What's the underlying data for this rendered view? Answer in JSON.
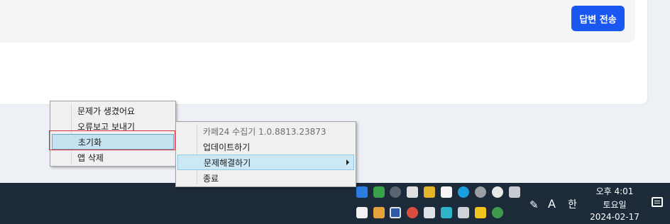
{
  "page": {
    "submit_button": "답변 전송"
  },
  "tray_menu": {
    "items": [
      "문제가 생겼어요",
      "오류보고 보내기",
      "초기화",
      "앱 삭제"
    ]
  },
  "app_menu": {
    "items": [
      "카페24 수집기 1.0.8813.23873",
      "업데이트하기",
      "문제해결하기",
      "종료"
    ]
  },
  "taskbar": {
    "time": "오후 4:01",
    "day": "토요일",
    "date": "2024-02-17",
    "ime_mode": "A",
    "ime_lang": "한",
    "tray_icons_row1": [
      "network-share-icon",
      "check-shield-icon",
      "chart-app-icon",
      "slack-icon",
      "folder-shield-icon",
      "dollar-app-icon",
      "edge-icon",
      "help-icon",
      "font-app-icon",
      "capture-app-icon"
    ],
    "tray_icons_row2": [
      "security-shield-icon",
      "image-viewer-icon",
      "display-icon",
      "color-app-icon",
      "network-icon",
      "defender-icon",
      "volume-icon",
      "kakao-icon",
      "chrome-icon"
    ],
    "colors": {
      "taskbar_bg": "#1c2a3a",
      "accent": "#1a56f0",
      "highlight": "#cce8f5",
      "red_outline": "#d9303a"
    }
  }
}
